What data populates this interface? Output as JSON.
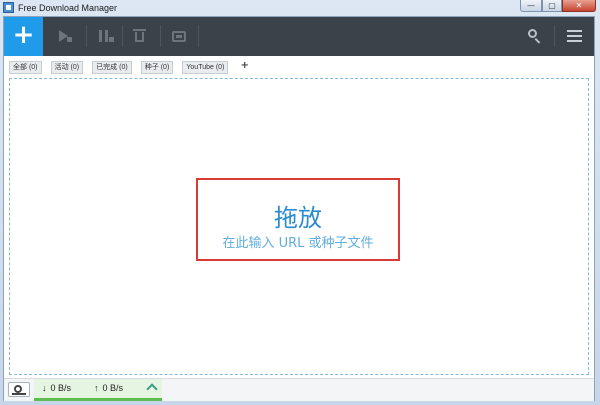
{
  "window": {
    "title": "Free Download Manager",
    "controls": {
      "minimize": "—",
      "maximize": "▢",
      "close": "✕"
    }
  },
  "toolbar": {
    "add_label": "+",
    "icons": [
      "play-icon",
      "pause-icon",
      "trash-icon",
      "move-icon",
      "search-icon",
      "menu-icon"
    ],
    "accent": "#1f9be9",
    "background": "#3c4249"
  },
  "tabs": [
    {
      "label": "全部 (0)"
    },
    {
      "label": "活动 (0)"
    },
    {
      "label": "已完成 (0)"
    },
    {
      "label": "种子 (0)"
    },
    {
      "label": "YouTube (0)"
    }
  ],
  "tab_add_label": "+",
  "dropzone": {
    "title": "拖放",
    "subtitle": "在此输入 URL 或种子文件",
    "highlight_color": "#d93a36"
  },
  "statusbar": {
    "download_arrow": "↓",
    "download_speed": "0 B/s",
    "upload_arrow": "↑",
    "upload_speed": "0 B/s",
    "accent": "#5dbb4f"
  }
}
